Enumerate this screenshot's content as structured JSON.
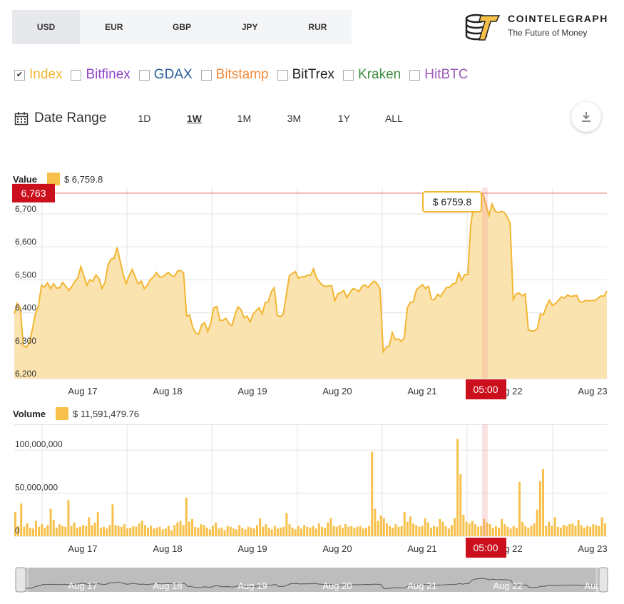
{
  "currencies": {
    "items": [
      "USD",
      "EUR",
      "GBP",
      "JPY",
      "RUR"
    ],
    "active": "USD"
  },
  "logo": {
    "title": "COINTELEGRAPH",
    "subtitle": "The Future of Money"
  },
  "exchanges": [
    {
      "label": "Index",
      "color": "#f2b632",
      "checked": true
    },
    {
      "label": "Bitfinex",
      "color": "#8e44c9",
      "checked": false
    },
    {
      "label": "GDAX",
      "color": "#2b5d9c",
      "checked": false
    },
    {
      "label": "Bitstamp",
      "color": "#ef8a3a",
      "checked": false
    },
    {
      "label": "BitTrex",
      "color": "#222222",
      "checked": false
    },
    {
      "label": "Kraken",
      "color": "#3f8f3f",
      "checked": false
    },
    {
      "label": "HitBTC",
      "color": "#9c5ab8",
      "checked": false
    }
  ],
  "check_mark": "✔",
  "range": {
    "label": "Date Range",
    "buttons": [
      "1D",
      "1W",
      "1M",
      "3M",
      "1Y",
      "ALL"
    ],
    "active": "1W"
  },
  "value_legend": {
    "label": "Value",
    "value": "$ 6,759.8"
  },
  "volume_legend": {
    "label": "Volume",
    "value": "$ 11,591,479.76"
  },
  "colors": {
    "accent": "#f7c04a",
    "line": "#f2b632",
    "fill": "#fbe3b0",
    "marker": "#cc0f1d",
    "grid": "#e3e3e3"
  },
  "chart_data": [
    {
      "type": "area",
      "ylim": [
        6200,
        6780
      ],
      "yticks": [
        "6,200",
        "6,300",
        "6,400",
        "6,500",
        "6,600",
        "6,700"
      ],
      "xticks": [
        "Aug 17",
        "Aug 18",
        "Aug 19",
        "Aug 20",
        "Aug 21",
        "Aug 22",
        "Aug 23"
      ],
      "current_marker": {
        "label": "6,763",
        "value": 6763
      },
      "tooltip": "$ 6759.8",
      "crosshair_label": "05:00",
      "values": [
        6397,
        6428,
        6415,
        6300,
        6295,
        6310,
        6350,
        6398,
        6420,
        6483,
        6478,
        6491,
        6473,
        6488,
        6475,
        6476,
        6492,
        6481,
        6468,
        6479,
        6495,
        6505,
        6540,
        6512,
        6483,
        6500,
        6496,
        6515,
        6504,
        6474,
        6491,
        6545,
        6563,
        6565,
        6598,
        6558,
        6518,
        6488,
        6512,
        6532,
        6509,
        6487,
        6496,
        6473,
        6484,
        6501,
        6508,
        6522,
        6510,
        6508,
        6517,
        6522,
        6513,
        6510,
        6527,
        6528,
        6521,
        6390,
        6393,
        6357,
        6338,
        6335,
        6364,
        6370,
        6343,
        6369,
        6415,
        6419,
        6377,
        6377,
        6383,
        6368,
        6361,
        6394,
        6418,
        6409,
        6385,
        6390,
        6372,
        6396,
        6406,
        6415,
        6396,
        6431,
        6433,
        6463,
        6476,
        6392,
        6388,
        6396,
        6456,
        6513,
        6519,
        6525,
        6505,
        6509,
        6509,
        6514,
        6514,
        6533,
        6505,
        6493,
        6483,
        6480,
        6482,
        6482,
        6436,
        6458,
        6461,
        6468,
        6446,
        6461,
        6473,
        6471,
        6464,
        6480,
        6485,
        6477,
        6488,
        6496,
        6488,
        6472,
        6282,
        6295,
        6298,
        6340,
        6318,
        6321,
        6313,
        6324,
        6415,
        6432,
        6433,
        6470,
        6478,
        6485,
        6474,
        6480,
        6440,
        6440,
        6456,
        6449,
        6464,
        6477,
        6477,
        6488,
        6489,
        6521,
        6498,
        6516,
        6516,
        6670,
        6727,
        6745,
        6762,
        6759,
        6730,
        6695,
        6730,
        6709,
        6703,
        6708,
        6705,
        6692,
        6671,
        6440,
        6457,
        6460,
        6451,
        6457,
        6348,
        6345,
        6345,
        6352,
        6396,
        6394,
        6420,
        6438,
        6422,
        6428,
        6438,
        6448,
        6445,
        6454,
        6449,
        6451,
        6453,
        6434,
        6432,
        6438,
        6436,
        6437,
        6437,
        6444,
        6451,
        6450,
        6466
      ]
    },
    {
      "type": "bar",
      "ylim": [
        0,
        130000000
      ],
      "yticks": [
        "0",
        "50,000,000",
        "100,000,000"
      ],
      "xticks": [
        "Aug 17",
        "Aug 18",
        "Aug 19",
        "Aug 20",
        "Aug 21",
        "Aug 22",
        "Aug 23"
      ],
      "crosshair_label": "05:00",
      "values": [
        28000000,
        12000000,
        38000000,
        11000000,
        15000000,
        10000000,
        9000000,
        18000000,
        11000000,
        14000000,
        10000000,
        13000000,
        32000000,
        19000000,
        10000000,
        14000000,
        12000000,
        11000000,
        42000000,
        12000000,
        16000000,
        10000000,
        11000000,
        13000000,
        12000000,
        22000000,
        13000000,
        16000000,
        28000000,
        10000000,
        11000000,
        9000000,
        13000000,
        37000000,
        13000000,
        12000000,
        11000000,
        14000000,
        9000000,
        10000000,
        12000000,
        11000000,
        15000000,
        18000000,
        13000000,
        10000000,
        12000000,
        9000000,
        10000000,
        11000000,
        8000000,
        9000000,
        12000000,
        7000000,
        13000000,
        16000000,
        18000000,
        13000000,
        45000000,
        17000000,
        20000000,
        11000000,
        10000000,
        14000000,
        13000000,
        10000000,
        8000000,
        12000000,
        16000000,
        9000000,
        10000000,
        7000000,
        12000000,
        11000000,
        9000000,
        8000000,
        13000000,
        10000000,
        8000000,
        11000000,
        10000000,
        9000000,
        13000000,
        21000000,
        11000000,
        14000000,
        10000000,
        8000000,
        12000000,
        9000000,
        10000000,
        11000000,
        27000000,
        14000000,
        10000000,
        8000000,
        12000000,
        9000000,
        13000000,
        11000000,
        10000000,
        12000000,
        9000000,
        15000000,
        11000000,
        10000000,
        16000000,
        21000000,
        12000000,
        11000000,
        13000000,
        10000000,
        14000000,
        11000000,
        12000000,
        10000000,
        11000000,
        12000000,
        9000000,
        10000000,
        12000000,
        98000000,
        32000000,
        18000000,
        24000000,
        21000000,
        15000000,
        12000000,
        10000000,
        14000000,
        11000000,
        12000000,
        28000000,
        17000000,
        23000000,
        15000000,
        13000000,
        11000000,
        12000000,
        21000000,
        16000000,
        10000000,
        12000000,
        11000000,
        20000000,
        17000000,
        12000000,
        9000000,
        13000000,
        21000000,
        113000000,
        72000000,
        25000000,
        17000000,
        15000000,
        18000000,
        14000000,
        11000000,
        12000000,
        20000000,
        16000000,
        14000000,
        10000000,
        12000000,
        10000000,
        20000000,
        14000000,
        11000000,
        9000000,
        12000000,
        10000000,
        63000000,
        17000000,
        12000000,
        10000000,
        12000000,
        15000000,
        31000000,
        64000000,
        78000000,
        12000000,
        17000000,
        12000000,
        22000000,
        11000000,
        10000000,
        13000000,
        12000000,
        14000000,
        15000000,
        12000000,
        19000000,
        13000000,
        10000000,
        12000000,
        11000000,
        14000000,
        13000000,
        12000000,
        22000000,
        15000000
      ]
    }
  ],
  "navigator": {
    "labels": [
      "Aug 17",
      "Aug 18",
      "Aug 19",
      "Aug 20",
      "Aug 21",
      "Aug 22",
      "Aug"
    ]
  }
}
